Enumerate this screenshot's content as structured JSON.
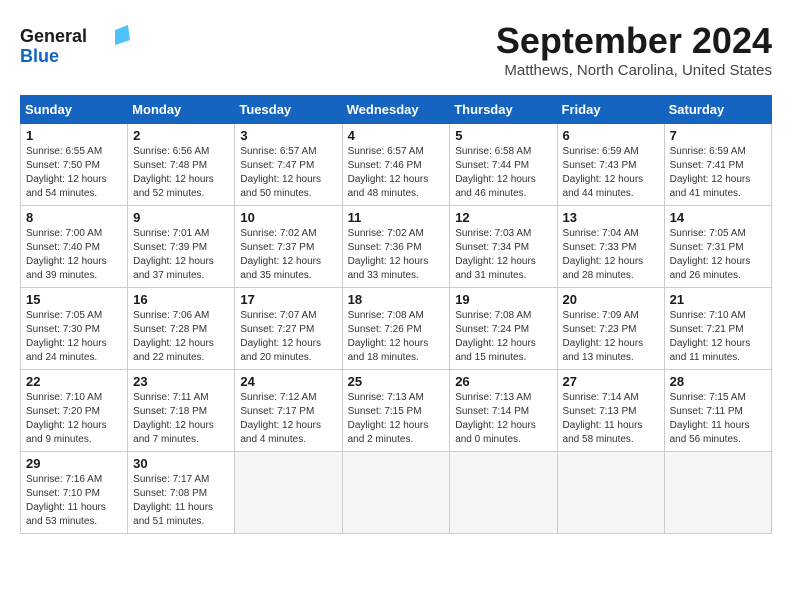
{
  "header": {
    "logo_line1": "General",
    "logo_line2": "Blue",
    "month_title": "September 2024",
    "location": "Matthews, North Carolina, United States"
  },
  "weekdays": [
    "Sunday",
    "Monday",
    "Tuesday",
    "Wednesday",
    "Thursday",
    "Friday",
    "Saturday"
  ],
  "weeks": [
    [
      {
        "day": "1",
        "sunrise": "6:55 AM",
        "sunset": "7:50 PM",
        "daylight": "12 hours and 54 minutes."
      },
      {
        "day": "2",
        "sunrise": "6:56 AM",
        "sunset": "7:48 PM",
        "daylight": "12 hours and 52 minutes."
      },
      {
        "day": "3",
        "sunrise": "6:57 AM",
        "sunset": "7:47 PM",
        "daylight": "12 hours and 50 minutes."
      },
      {
        "day": "4",
        "sunrise": "6:57 AM",
        "sunset": "7:46 PM",
        "daylight": "12 hours and 48 minutes."
      },
      {
        "day": "5",
        "sunrise": "6:58 AM",
        "sunset": "7:44 PM",
        "daylight": "12 hours and 46 minutes."
      },
      {
        "day": "6",
        "sunrise": "6:59 AM",
        "sunset": "7:43 PM",
        "daylight": "12 hours and 44 minutes."
      },
      {
        "day": "7",
        "sunrise": "6:59 AM",
        "sunset": "7:41 PM",
        "daylight": "12 hours and 41 minutes."
      }
    ],
    [
      {
        "day": "8",
        "sunrise": "7:00 AM",
        "sunset": "7:40 PM",
        "daylight": "12 hours and 39 minutes."
      },
      {
        "day": "9",
        "sunrise": "7:01 AM",
        "sunset": "7:39 PM",
        "daylight": "12 hours and 37 minutes."
      },
      {
        "day": "10",
        "sunrise": "7:02 AM",
        "sunset": "7:37 PM",
        "daylight": "12 hours and 35 minutes."
      },
      {
        "day": "11",
        "sunrise": "7:02 AM",
        "sunset": "7:36 PM",
        "daylight": "12 hours and 33 minutes."
      },
      {
        "day": "12",
        "sunrise": "7:03 AM",
        "sunset": "7:34 PM",
        "daylight": "12 hours and 31 minutes."
      },
      {
        "day": "13",
        "sunrise": "7:04 AM",
        "sunset": "7:33 PM",
        "daylight": "12 hours and 28 minutes."
      },
      {
        "day": "14",
        "sunrise": "7:05 AM",
        "sunset": "7:31 PM",
        "daylight": "12 hours and 26 minutes."
      }
    ],
    [
      {
        "day": "15",
        "sunrise": "7:05 AM",
        "sunset": "7:30 PM",
        "daylight": "12 hours and 24 minutes."
      },
      {
        "day": "16",
        "sunrise": "7:06 AM",
        "sunset": "7:28 PM",
        "daylight": "12 hours and 22 minutes."
      },
      {
        "day": "17",
        "sunrise": "7:07 AM",
        "sunset": "7:27 PM",
        "daylight": "12 hours and 20 minutes."
      },
      {
        "day": "18",
        "sunrise": "7:08 AM",
        "sunset": "7:26 PM",
        "daylight": "12 hours and 18 minutes."
      },
      {
        "day": "19",
        "sunrise": "7:08 AM",
        "sunset": "7:24 PM",
        "daylight": "12 hours and 15 minutes."
      },
      {
        "day": "20",
        "sunrise": "7:09 AM",
        "sunset": "7:23 PM",
        "daylight": "12 hours and 13 minutes."
      },
      {
        "day": "21",
        "sunrise": "7:10 AM",
        "sunset": "7:21 PM",
        "daylight": "12 hours and 11 minutes."
      }
    ],
    [
      {
        "day": "22",
        "sunrise": "7:10 AM",
        "sunset": "7:20 PM",
        "daylight": "12 hours and 9 minutes."
      },
      {
        "day": "23",
        "sunrise": "7:11 AM",
        "sunset": "7:18 PM",
        "daylight": "12 hours and 7 minutes."
      },
      {
        "day": "24",
        "sunrise": "7:12 AM",
        "sunset": "7:17 PM",
        "daylight": "12 hours and 4 minutes."
      },
      {
        "day": "25",
        "sunrise": "7:13 AM",
        "sunset": "7:15 PM",
        "daylight": "12 hours and 2 minutes."
      },
      {
        "day": "26",
        "sunrise": "7:13 AM",
        "sunset": "7:14 PM",
        "daylight": "12 hours and 0 minutes."
      },
      {
        "day": "27",
        "sunrise": "7:14 AM",
        "sunset": "7:13 PM",
        "daylight": "11 hours and 58 minutes."
      },
      {
        "day": "28",
        "sunrise": "7:15 AM",
        "sunset": "7:11 PM",
        "daylight": "11 hours and 56 minutes."
      }
    ],
    [
      {
        "day": "29",
        "sunrise": "7:16 AM",
        "sunset": "7:10 PM",
        "daylight": "11 hours and 53 minutes."
      },
      {
        "day": "30",
        "sunrise": "7:17 AM",
        "sunset": "7:08 PM",
        "daylight": "11 hours and 51 minutes."
      },
      null,
      null,
      null,
      null,
      null
    ]
  ]
}
